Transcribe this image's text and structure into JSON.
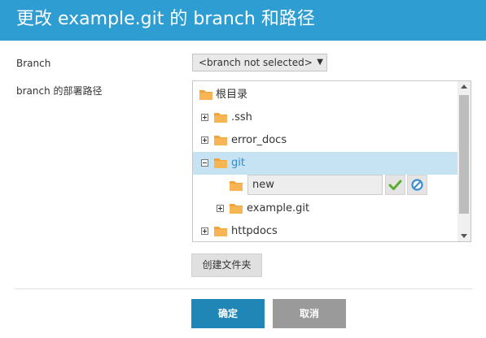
{
  "dialog": {
    "title": "更改 example.git 的 branch 和路径"
  },
  "form": {
    "branch_label": "Branch",
    "branch_select_value": "<branch not selected>",
    "path_label": "branch 的部署路径"
  },
  "tree": {
    "root": "根目录",
    "items": [
      {
        "label": ".ssh"
      },
      {
        "label": "error_docs"
      },
      {
        "label": "git"
      },
      {
        "label": "example.git"
      },
      {
        "label": "httpdocs"
      }
    ],
    "new_folder_value": "new"
  },
  "buttons": {
    "create_folder": "创建文件夹",
    "ok": "确定",
    "cancel": "取消"
  },
  "colors": {
    "header": "#2e9dd1",
    "ok": "#1f86b5",
    "cancel": "#9a9a9a",
    "selected_row": "#c6e3f3",
    "folder": "#f5a23a"
  },
  "icons": {
    "confirm": "checkmark-icon",
    "cancel": "cancel-circle-icon",
    "folder": "folder-icon"
  }
}
